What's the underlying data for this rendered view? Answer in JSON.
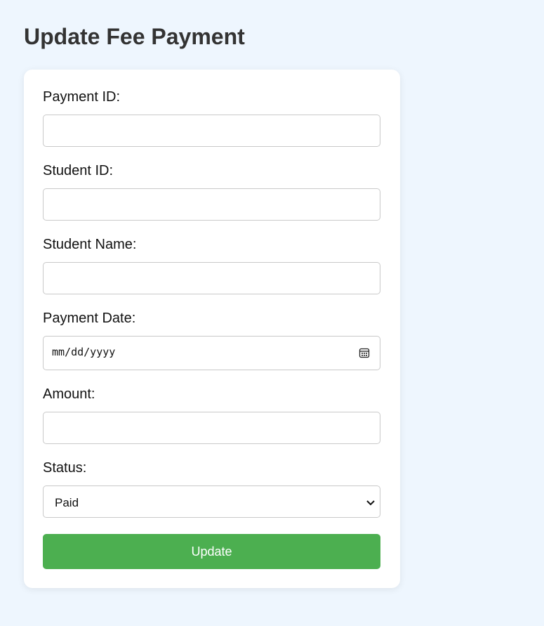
{
  "page": {
    "title": "Update Fee Payment"
  },
  "form": {
    "fields": {
      "payment_id": {
        "label": "Payment ID:",
        "value": ""
      },
      "student_id": {
        "label": "Student ID:",
        "value": ""
      },
      "student_name": {
        "label": "Student Name:",
        "value": ""
      },
      "payment_date": {
        "label": "Payment Date:",
        "placeholder": "mm/dd/yyyy",
        "icon": "calendar-icon"
      },
      "amount": {
        "label": "Amount:",
        "value": ""
      },
      "status": {
        "label": "Status:",
        "selected": "Paid",
        "icon": "chevron-down-icon"
      }
    },
    "submit_label": "Update"
  },
  "colors": {
    "background": "#eef6fe",
    "card": "#ffffff",
    "button": "#4caf50",
    "title": "#333333"
  }
}
